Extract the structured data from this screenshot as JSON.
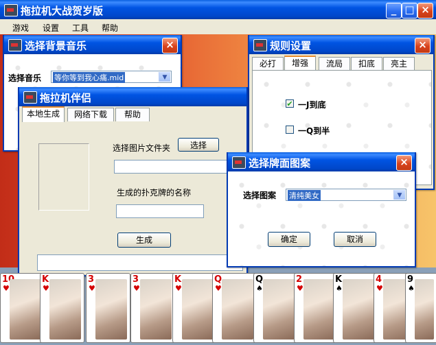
{
  "main": {
    "title": "拖拉机大战贺岁版",
    "menu": [
      "游戏",
      "设置",
      "工具",
      "帮助"
    ]
  },
  "music_dialog": {
    "title": "选择背景音乐",
    "label": "选择音乐",
    "selected": "等你等到我心痛.mid"
  },
  "rules_dialog": {
    "title": "规则设置",
    "tabs": [
      "必打",
      "增强",
      "流局",
      "扣底",
      "亮主"
    ],
    "options": [
      {
        "label": "一J到底",
        "checked": true
      },
      {
        "label": "一Q到半",
        "checked": false
      }
    ]
  },
  "partner_dialog": {
    "title": "拖拉机伴侣",
    "tabs": [
      "本地生成",
      "网络下载",
      "帮助"
    ],
    "folder_label": "选择图片文件夹",
    "select_button": "选择",
    "name_label": "生成的扑克牌的名称",
    "generate_button": "生成"
  },
  "pattern_dialog": {
    "title": "选择牌面图案",
    "label": "选择图案",
    "selected": "清纯美女",
    "ok_button": "确定",
    "cancel_button": "取消"
  },
  "cards": [
    {
      "rank": "10",
      "suit": "♥",
      "color": "red"
    },
    {
      "rank": "K",
      "suit": "♥",
      "color": "red"
    },
    {
      "rank": "3",
      "suit": "♥",
      "color": "red"
    },
    {
      "rank": "3",
      "suit": "♥",
      "color": "red"
    },
    {
      "rank": "K",
      "suit": "♥",
      "color": "red"
    },
    {
      "rank": "Q",
      "suit": "♥",
      "color": "red"
    },
    {
      "rank": "Q",
      "suit": "♠",
      "color": "black"
    },
    {
      "rank": "2",
      "suit": "♥",
      "color": "red"
    },
    {
      "rank": "K",
      "suit": "♠",
      "color": "black"
    },
    {
      "rank": "4",
      "suit": "♥",
      "color": "red"
    },
    {
      "rank": "9",
      "suit": "♠",
      "color": "black"
    }
  ],
  "colors": {
    "titlebar": "#0054e3",
    "dialog_bg": "#ece9d8",
    "accent_red": "#d40000"
  }
}
